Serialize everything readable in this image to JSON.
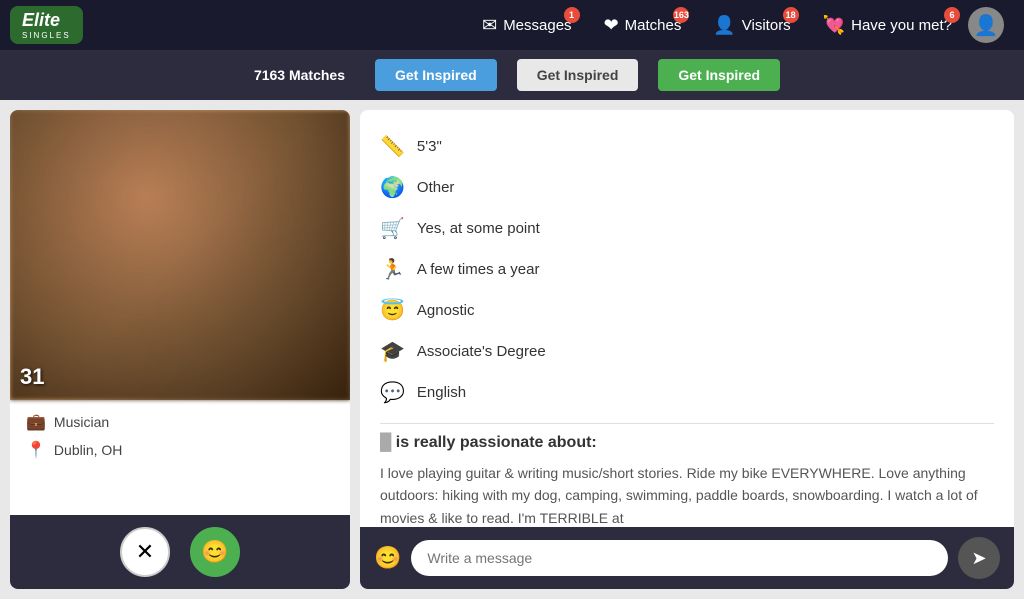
{
  "nav": {
    "logo": "Elite",
    "logo_sub": "SINGLES",
    "messages_label": "Messages",
    "messages_badge": "1",
    "matches_label": "Matches",
    "matches_badge": "163",
    "visitors_label": "Visitors",
    "visitors_badge": "18",
    "haveyoumet_label": "Have you met?",
    "haveyoumet_badge": "6"
  },
  "subnav": {
    "matches_count": "7163 Matches",
    "btn1_label": "Get Inspired",
    "btn2_label": "Get Inspired",
    "btn3_label": "Get Inspired"
  },
  "profile": {
    "age": "31",
    "job": "Musician",
    "location": "Dublin, OH",
    "height": "5'3\"",
    "ethnicity": "Other",
    "children": "Yes, at some point",
    "exercise": "A few times a year",
    "religion": "Agnostic",
    "education": "Associate's Degree",
    "language": "English",
    "passion_heading": "is really passionate about:",
    "passion_text": "I love playing guitar & writing music/short stories. Ride my bike EVERYWHERE. Love anything outdoors: hiking with my dog, camping, swimming, paddle boards, snowboarding. I watch a lot of movies & like to read. I'm TERRIBLE at",
    "message_placeholder": "Write a message"
  },
  "icons": {
    "height": "📏",
    "ethnicity": "🌍",
    "children": "🛒",
    "exercise": "🏃",
    "religion": "😇",
    "education": "🎓",
    "language": "💬",
    "job": "💼",
    "location": "📍",
    "close": "✕",
    "like": "😊",
    "emoji": "😊",
    "send": "➤"
  }
}
